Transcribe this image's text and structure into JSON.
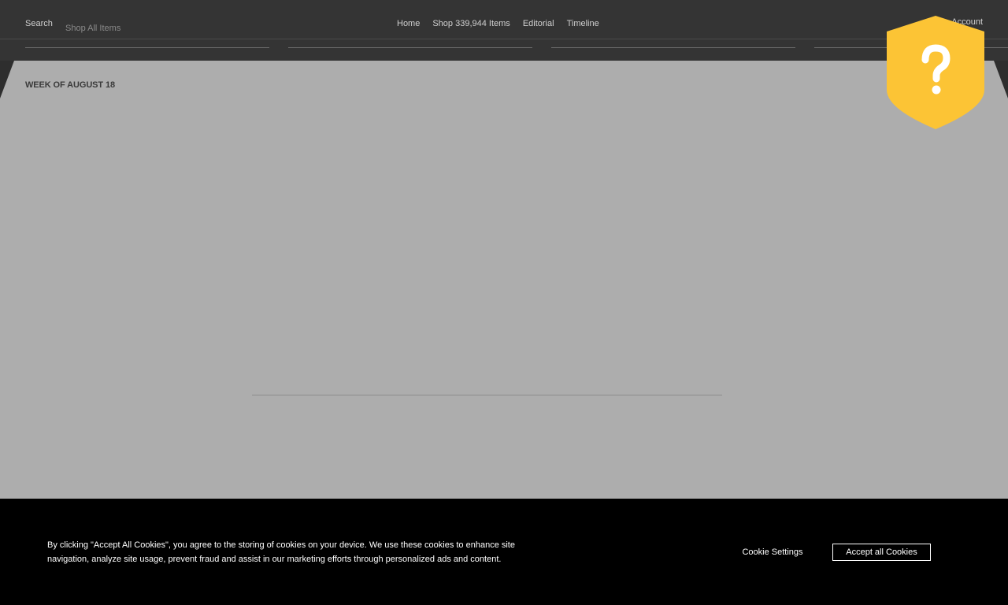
{
  "header": {
    "search_label": "Search",
    "search_overlay_text": "Shop All Items",
    "nav": [
      {
        "label": "Home"
      },
      {
        "label": "Shop 339,944 Items"
      },
      {
        "label": "Editorial"
      },
      {
        "label": "Timeline"
      }
    ],
    "account_label": "Account"
  },
  "main": {
    "week_heading": "WEEK OF AUGUST 18"
  },
  "help_badge": {
    "icon": "question-shield-icon",
    "color": "#fcc435",
    "glyph": "?"
  },
  "cookie_banner": {
    "text": "By clicking \"Accept All Cookies\", you agree to the storing of cookies on your device. We use these cookies to enhance site navigation, analyze site usage, prevent fraud and assist in our marketing efforts through personalized ads and content.",
    "settings_label": "Cookie Settings",
    "accept_label": "Accept all Cookies"
  },
  "colors": {
    "header_bg": "#343434",
    "content_bg": "#adadad",
    "banner_bg": "#000000",
    "accent": "#fcc435"
  }
}
